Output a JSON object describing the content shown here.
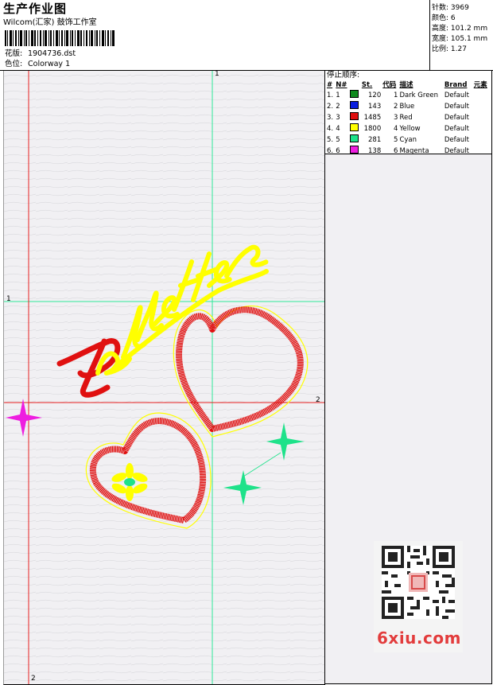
{
  "header": {
    "title": "生产作业图",
    "company": "Wilcom(汇家) 鼓饰工作室",
    "design_label": "花版:",
    "design_value": "1904736.dst",
    "colorway_label": "色位:",
    "colorway_value": "Colorway 1"
  },
  "stats": {
    "stitches_label": "针数:",
    "stitches_value": "3969",
    "colors_label": "颜色:",
    "colors_value": "6",
    "height_label": "高度:",
    "height_value": "101.2 mm",
    "width_label": "宽度:",
    "width_value": "105.1 mm",
    "scale_label": "比例:",
    "scale_value": "1.27"
  },
  "stop_sequence": {
    "heading": "停止顺序:",
    "columns": [
      "#",
      "N#",
      "St.",
      "代码",
      "描述",
      "Brand",
      "元素"
    ],
    "rows": [
      {
        "idx": "1.",
        "n": "1",
        "color": "#0f8a1e",
        "st": "120",
        "code": "1",
        "desc": "Dark Green",
        "brand": "Default"
      },
      {
        "idx": "2.",
        "n": "2",
        "color": "#0a1ee0",
        "st": "143",
        "code": "2",
        "desc": "Blue",
        "brand": "Default"
      },
      {
        "idx": "3.",
        "n": "3",
        "color": "#e01010",
        "st": "1485",
        "code": "3",
        "desc": "Red",
        "brand": "Default"
      },
      {
        "idx": "4.",
        "n": "4",
        "color": "#ffff00",
        "st": "1800",
        "code": "4",
        "desc": "Yellow",
        "brand": "Default"
      },
      {
        "idx": "5.",
        "n": "5",
        "color": "#1ee28a",
        "st": "281",
        "code": "5",
        "desc": "Cyan",
        "brand": "Default"
      },
      {
        "idx": "6.",
        "n": "6",
        "color": "#ee1ee0",
        "st": "138",
        "code": "6",
        "desc": "Magenta",
        "brand": "Default"
      }
    ]
  },
  "guides": {
    "top_label": "1",
    "left_label": "1",
    "right_label": "2",
    "bottom_label": "2"
  },
  "watermark": {
    "site": "6xiu.com"
  },
  "colors": {
    "guide_green": "#2ee89a",
    "guide_red": "#e82020",
    "canvas_bg": "#f1f0f3"
  }
}
